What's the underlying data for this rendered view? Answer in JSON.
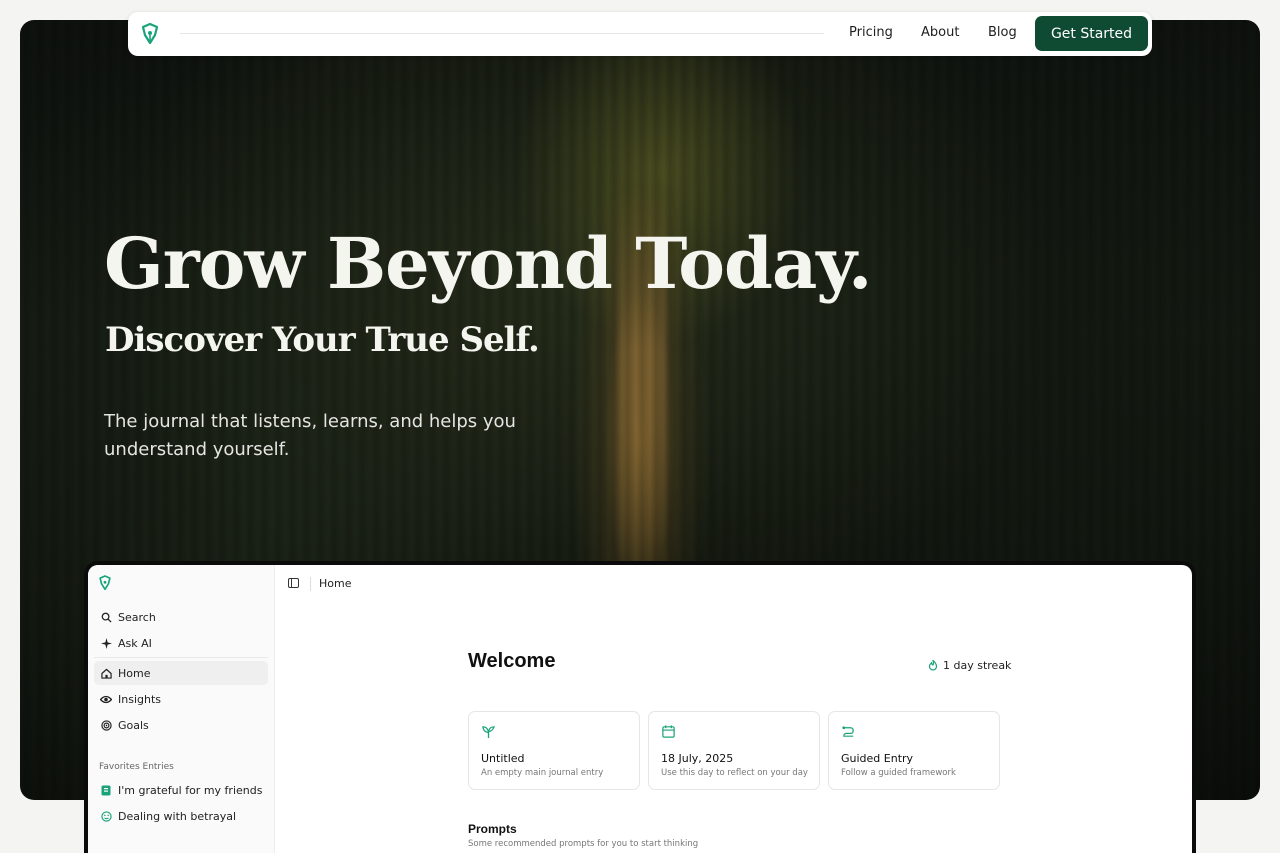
{
  "colors": {
    "brand_green": "#0f4a33",
    "accent_green": "#1aa37a",
    "page_bg": "#f4f4f2"
  },
  "nav": {
    "logo_icon": "pen-nib-logo-icon",
    "links": [
      "Pricing",
      "About",
      "Blog"
    ],
    "cta": "Get Started"
  },
  "hero": {
    "headline": "Grow Beyond Today.",
    "subheadline": "Discover Your True Self.",
    "lede": "The journal that listens, learns, and helps you understand yourself."
  },
  "app": {
    "sidebar": {
      "logo_icon": "pen-nib-logo-icon",
      "tools": [
        {
          "label": "Search",
          "icon": "search-icon"
        },
        {
          "label": "Ask AI",
          "icon": "sparkle-icon"
        }
      ],
      "nav": [
        {
          "label": "Home",
          "icon": "home-icon",
          "active": true
        },
        {
          "label": "Insights",
          "icon": "eye-icon"
        },
        {
          "label": "Goals",
          "icon": "target-icon"
        }
      ],
      "favorites_heading": "Favorites Entries",
      "favorites": [
        {
          "label": "I'm grateful for my friends",
          "icon": "journal-icon"
        },
        {
          "label": "Dealing with betrayal",
          "icon": "smile-icon"
        }
      ]
    },
    "topbar": {
      "breadcrumb": "Home"
    },
    "main": {
      "title": "Welcome",
      "streak": "1 day streak",
      "cards": [
        {
          "title": "Untitled",
          "subtitle": "An empty main journal entry",
          "icon": "sprout-icon"
        },
        {
          "title": "18 July, 2025",
          "subtitle": "Use this day to reflect on your day",
          "icon": "calendar-icon"
        },
        {
          "title": "Guided Entry",
          "subtitle": "Follow a guided framework",
          "icon": "route-icon"
        }
      ],
      "prompts_title": "Prompts",
      "prompts_subtitle": "Some recommended prompts for you to start thinking"
    }
  }
}
